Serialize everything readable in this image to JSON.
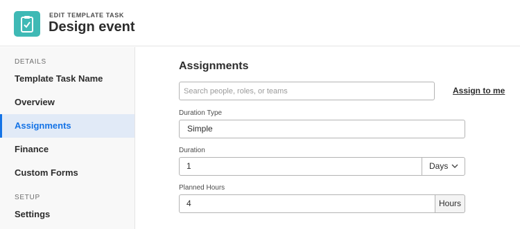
{
  "header": {
    "eyebrow": "EDIT TEMPLATE TASK",
    "title": "Design event",
    "icon": "clipboard-check-icon",
    "accent_color": "#3fb9b5"
  },
  "sidebar": {
    "sections": [
      {
        "label": "DETAILS"
      },
      {
        "label": "SETUP"
      }
    ],
    "items": [
      {
        "label": "Template Task Name",
        "active": false
      },
      {
        "label": "Overview",
        "active": false
      },
      {
        "label": "Assignments",
        "active": true
      },
      {
        "label": "Finance",
        "active": false
      },
      {
        "label": "Custom Forms",
        "active": false
      },
      {
        "label": "Settings",
        "active": false
      }
    ],
    "active_color": "#1473e6"
  },
  "main": {
    "title": "Assignments",
    "search": {
      "placeholder": "Search people, roles, or teams",
      "value": ""
    },
    "assign_to_me": "Assign to me",
    "duration_type": {
      "label": "Duration Type",
      "value": "Simple"
    },
    "duration": {
      "label": "Duration",
      "value": "1",
      "unit": "Days"
    },
    "planned_hours": {
      "label": "Planned Hours",
      "value": "4",
      "unit": "Hours"
    }
  }
}
